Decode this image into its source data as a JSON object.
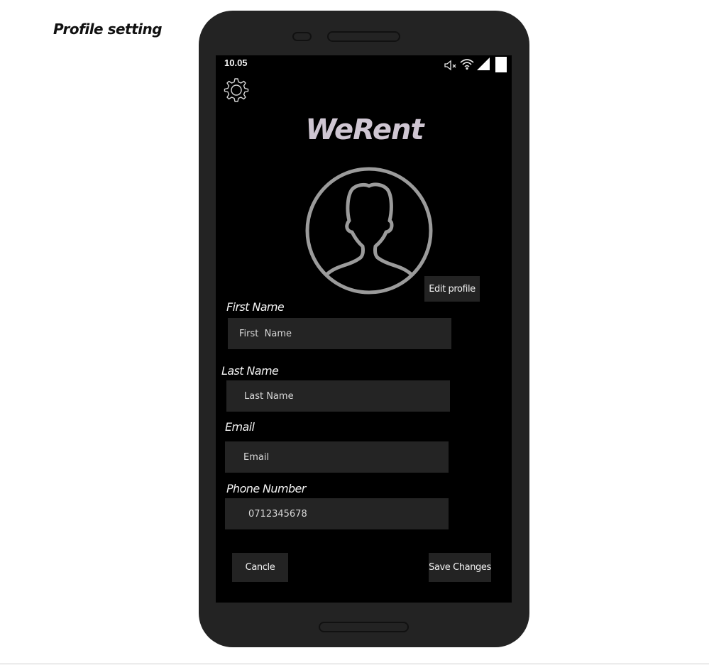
{
  "page": {
    "heading": "Profile setting"
  },
  "status_bar": {
    "time": "10.05",
    "icons": [
      "muted-speaker-icon",
      "wifi-icon",
      "cellular-signal-icon",
      "battery-icon"
    ]
  },
  "settings": {
    "icon": "gear-icon"
  },
  "app": {
    "title": "WeRent"
  },
  "profile": {
    "avatar_icon": "user-silhouette-icon",
    "edit_label": "Edit profile"
  },
  "form": {
    "first_name": {
      "label": "First Name",
      "placeholder": "First  Name",
      "value": ""
    },
    "last_name": {
      "label": "Last Name",
      "placeholder": "Last Name",
      "value": ""
    },
    "email": {
      "label": "Email",
      "placeholder": "Email",
      "value": ""
    },
    "phone": {
      "label": "Phone Number",
      "placeholder": "",
      "value": "0712345678"
    }
  },
  "actions": {
    "cancel_label": "Cancle",
    "save_label": "Save Changes"
  },
  "colors": {
    "phone_body": "#232323",
    "screen_background": "#000000",
    "field_background": "#242424",
    "title_color": "#cfc6d2",
    "avatar_stroke": "#9b9b9b"
  }
}
